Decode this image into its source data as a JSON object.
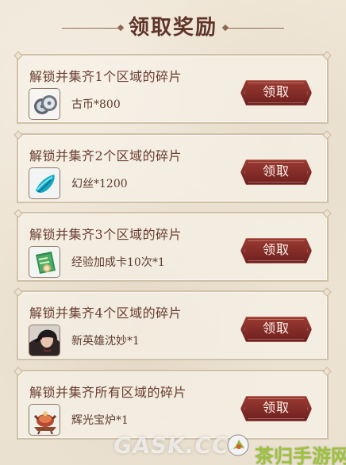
{
  "title": "领取奖励",
  "rewards": [
    {
      "requirement": "解锁并集齐1个区域的碎片",
      "item": "古币*800",
      "button": "领取",
      "icon": "coin-icon"
    },
    {
      "requirement": "解锁并集齐2个区域的碎片",
      "item": "幻丝*1200",
      "button": "领取",
      "icon": "silk-icon"
    },
    {
      "requirement": "解锁并集齐3个区域的碎片",
      "item": "经验加成卡10次*1",
      "button": "领取",
      "icon": "experience-card-icon"
    },
    {
      "requirement": "解锁并集齐4个区域的碎片",
      "item": "新英雄沈妙*1",
      "button": "领取",
      "icon": "hero-portrait-icon"
    },
    {
      "requirement": "解锁并集齐所有区域的碎片",
      "item": "辉光宝炉*1",
      "button": "领取",
      "icon": "treasure-furnace-icon"
    }
  ],
  "watermark": {
    "left": "GASK.CC",
    "right": "茶归手游网"
  },
  "colors": {
    "title": "#5f3529",
    "button": "#7f2727",
    "card_border": "#d0c1a8"
  }
}
